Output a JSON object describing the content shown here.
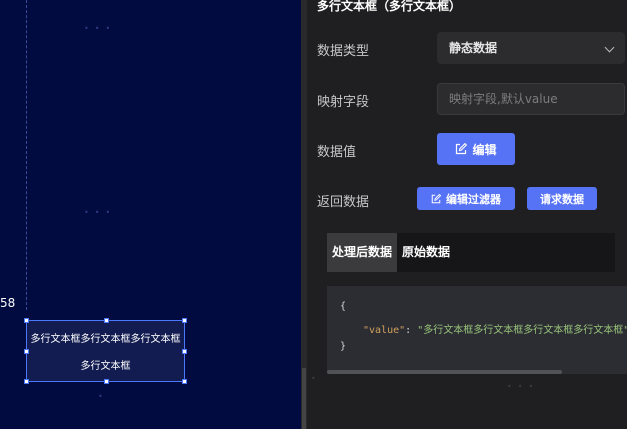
{
  "canvas": {
    "ruler_value": "58",
    "widget_text": "多行文本框多行文本框多行文本框多行文本框"
  },
  "panel": {
    "title": "多行文本框（多行文本框）",
    "data_type": {
      "label": "数据类型",
      "value": "静态数据"
    },
    "mapping": {
      "label": "映射字段",
      "placeholder": "映射字段,默认value"
    },
    "data_value": {
      "label": "数据值",
      "edit_button": "编辑"
    },
    "return_data": {
      "label": "返回数据",
      "edit_filter_button": "编辑过滤器",
      "request_button": "请求数据"
    },
    "tabs": [
      {
        "label": "处理后数据",
        "active": true
      },
      {
        "label": "原始数据",
        "active": false
      }
    ],
    "code": {
      "open": "{",
      "key": "\"value\"",
      "sep": ": ",
      "value": "\"多行文本框多行文本框多行文本框多行文本框\"",
      "close": "}"
    }
  },
  "colors": {
    "canvas_bg": "#020b3f",
    "panel_bg": "#1f1f21",
    "accent": "#5773f5",
    "selection": "#4a78ff"
  },
  "icons": [
    "edit-icon",
    "chevron-down-icon",
    "resize-handle"
  ]
}
